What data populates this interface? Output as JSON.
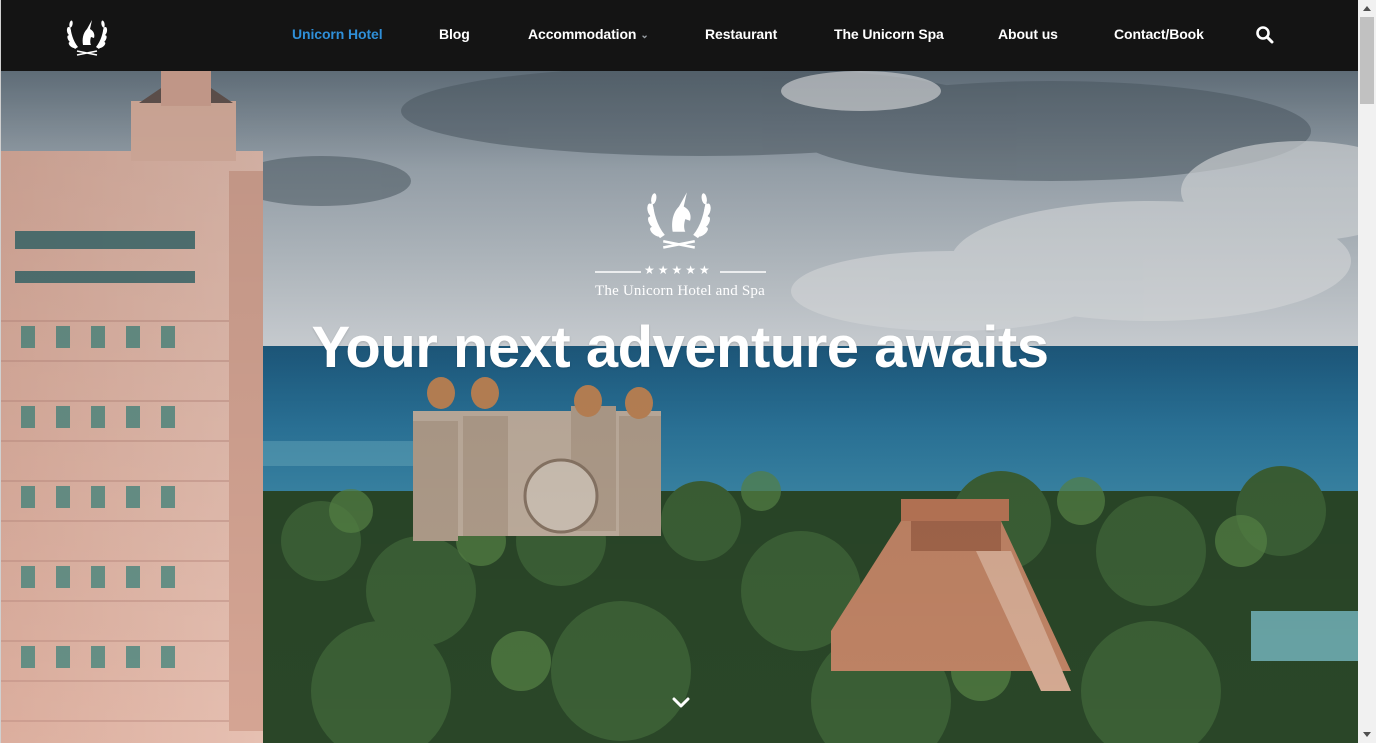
{
  "nav": {
    "logo_icon": "unicorn-laurel-logo",
    "items": [
      {
        "label": "Unicorn Hotel",
        "active": true
      },
      {
        "label": "Blog"
      },
      {
        "label": "Accommodation",
        "has_dropdown": true
      },
      {
        "label": "Restaurant"
      },
      {
        "label": "The Unicorn Spa"
      },
      {
        "label": "About us"
      },
      {
        "label": "Contact/Book"
      }
    ],
    "search_icon": "search-icon"
  },
  "hero": {
    "logo_icon": "unicorn-laurel-logo",
    "stars": "★★★★★",
    "subtitle": "The Unicorn Hotel and Spa",
    "title": "Your next adventure awaits",
    "scroll_icon": "chevron-down-icon"
  },
  "colors": {
    "navbar_bg": "#141414",
    "active_link": "#2f8fd8",
    "text": "#ffffff"
  }
}
